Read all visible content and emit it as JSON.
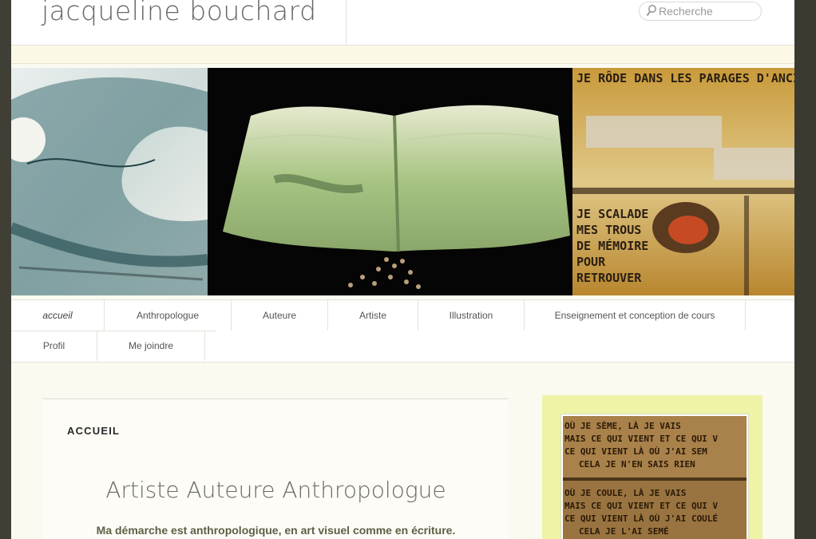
{
  "site": {
    "title": "jacqueline bouchard"
  },
  "search": {
    "placeholder": "Recherche"
  },
  "banner": {
    "panel_left": "",
    "panel_center": "",
    "panel_right_text": [
      "JE RÔDE DANS LES PARAGES D'ANCIEN",
      "JE SCALADE",
      "MES TROUS",
      "DE MÉMOIRE",
      "POUR",
      "RETROUVER"
    ]
  },
  "nav": {
    "items": [
      {
        "label": "accueil",
        "current": true
      },
      {
        "label": "Anthropologue"
      },
      {
        "label": "Auteure"
      },
      {
        "label": "Artiste"
      },
      {
        "label": "Illustration"
      },
      {
        "label": "Enseignement et conception de cours"
      },
      {
        "label": "Profil"
      },
      {
        "label": "Me joindre"
      }
    ]
  },
  "entry": {
    "label": "ACCUEIL",
    "heading": "Artiste Auteure Anthropologue",
    "lead": "Ma démarche est anthropologique, en art visuel comme en écriture."
  },
  "sidebar": {
    "image_text": [
      "OÙ JE SÈME, LÀ JE VAIS",
      "MAIS CE QUI VIENT ET CE QUI V",
      "CE QUI VIENT LÀ OÙ J'AI SEM",
      "CELA JE N'EN SAIS RIEN",
      "OÙ JE COULE, LÀ JE VAIS",
      "MAIS CE QUI VIENT ET CE QUI V",
      "CE QUI VIENT LÀ OÙ J'AI COULÉ",
      "CELA JE L'AI SEMÉ"
    ]
  },
  "colors": {
    "page_bg": "#fbfaf1",
    "band": "#fbf8e7",
    "sidebar_bg": "#eef3a5",
    "outer_bg": "#3f3f35"
  }
}
